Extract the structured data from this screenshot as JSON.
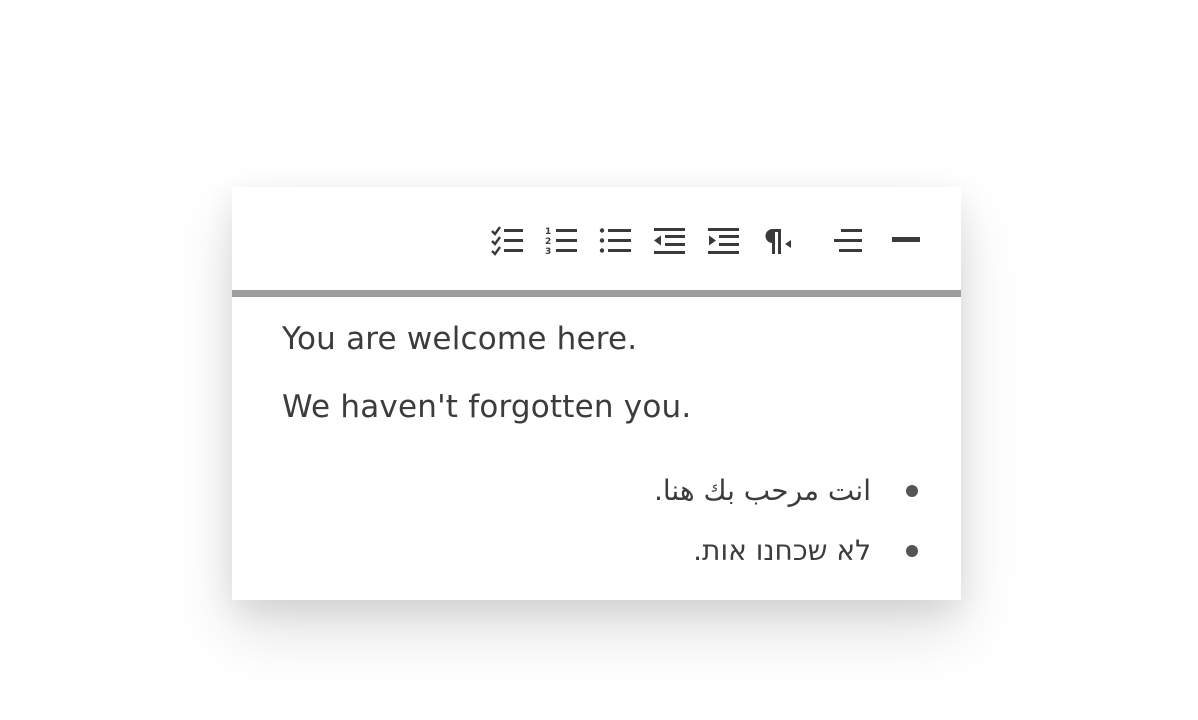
{
  "toolbar": {
    "tools": [
      {
        "name": "checklist-icon"
      },
      {
        "name": "numbered-list-icon"
      },
      {
        "name": "bulleted-list-icon"
      },
      {
        "name": "outdent-icon"
      },
      {
        "name": "indent-icon"
      },
      {
        "name": "text-direction-rtl-icon"
      },
      {
        "name": "align-right-icon"
      },
      {
        "name": "horizontal-rule-icon"
      }
    ]
  },
  "content": {
    "paragraphs": [
      "You are welcome here.",
      "We haven't forgotten you."
    ],
    "rtl_list": [
      "انت مرحب بك هنا.",
      "לא שכחנו אות."
    ]
  },
  "colors": {
    "text": "#3c3c3c",
    "icon": "#3a3a3a",
    "divider": "#9d9d9d"
  }
}
